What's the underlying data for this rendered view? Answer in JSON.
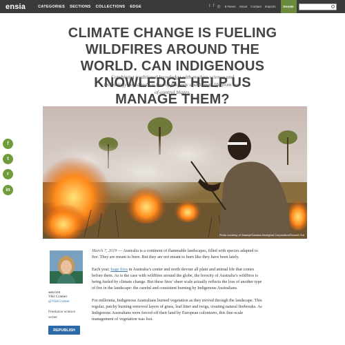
{
  "nav": {
    "logo": "ensia",
    "items": [
      "CATEGORIES",
      "SECTIONS",
      "COLLECTIONS",
      "EDGE"
    ],
    "social": [
      "t",
      "f",
      "a"
    ],
    "links": [
      "E-News",
      "About",
      "Contact",
      "Impacts"
    ],
    "donate": "Donate",
    "search_placeholder": ""
  },
  "article": {
    "headline": "CLIMATE CHANGE IS FUELING WILDFIRES AROUND THE WORLD. CAN INDIGENOUS KNOWLEDGE HELP US MANAGE THEM?",
    "subhead": "Combining traditional knowledge with modern science and technology could reduce loss of property and human life from out-of-control blazes.",
    "photo_credit": "Photo courtesy of Waanyi/Garawa Aboriginal Corporation/Russell Ord",
    "date": "March 7, 2019",
    "p1_rest": " — Australia is a continent of flammable landscapes, filled with species adapted to fire. They are meant to burn. But they are not meant to burn like they have been lately.",
    "p2_start": "Each year, ",
    "p2_link": "huge fires",
    "p2_rest": " in Australia’s center and north devour all plant and animal life that comes before them. As is the case with wildfires around the globe, the ferocity of Australia’s wildfires is being fueled by climate change. But these fires’ sheer scale actually reflects the loss of another type of fire in the landscape: the careful and consistent burning by Indigenous Australians.",
    "p3": "For millennia, Indigenous Australians burned vegetation as they moved through the landscape. This regular, patchy burning removed layers of grass, leaf litter and twigs, creating natural firebreaks. As Indigenous Australians were forced off their land by European colonizers, this fine-scale management of vegetation was lost."
  },
  "author": {
    "label": "WRITER",
    "name": "Viki Cramer",
    "handle": "@VikiCramer",
    "bio": "Freelance science writer",
    "republish": "REPUBLISH"
  },
  "share": {
    "facebook": "f",
    "twitter": "t",
    "reddit": "r",
    "linkedin": "in"
  },
  "colors": {
    "topbar": "#3a3a3a",
    "donate": "#6a8a3e",
    "share": "#6f9b3a",
    "republish": "#2b6aa6",
    "link": "#3a7ab8"
  }
}
